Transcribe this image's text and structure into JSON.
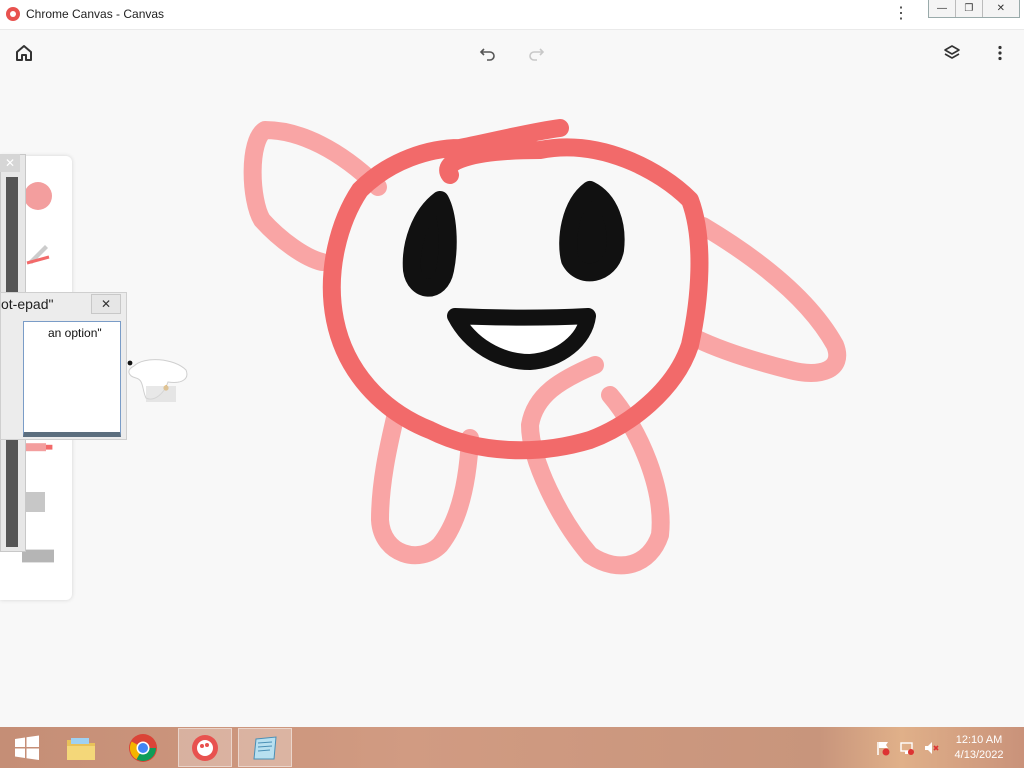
{
  "window": {
    "title": "Chrome Canvas - Canvas",
    "menu_glyph": "⋮",
    "minimize_glyph": "—",
    "restore_glyph": "❐",
    "close_glyph": "✕"
  },
  "toolbar": {
    "home_icon": "home-icon",
    "undo_icon": "undo-icon",
    "redo_icon": "redo-icon",
    "layers_icon": "layers-icon",
    "more_icon": "more-vert-icon"
  },
  "tools_panel": {
    "selected_color": "#f39e9e"
  },
  "overlay": {
    "close_glyph": "✕"
  },
  "popup": {
    "title": "ot-epad\"",
    "close_glyph": "✕",
    "item": "an option\""
  },
  "taskbar": {
    "apps": [
      "start-button",
      "file-explorer",
      "chrome",
      "chrome-canvas",
      "notepad"
    ],
    "time": "12:10 AM",
    "date": "4/13/2022"
  },
  "colors": {
    "stroke_red": "#f26a6a",
    "stroke_pink": "#f9a5a5",
    "stroke_black": "#111111"
  }
}
